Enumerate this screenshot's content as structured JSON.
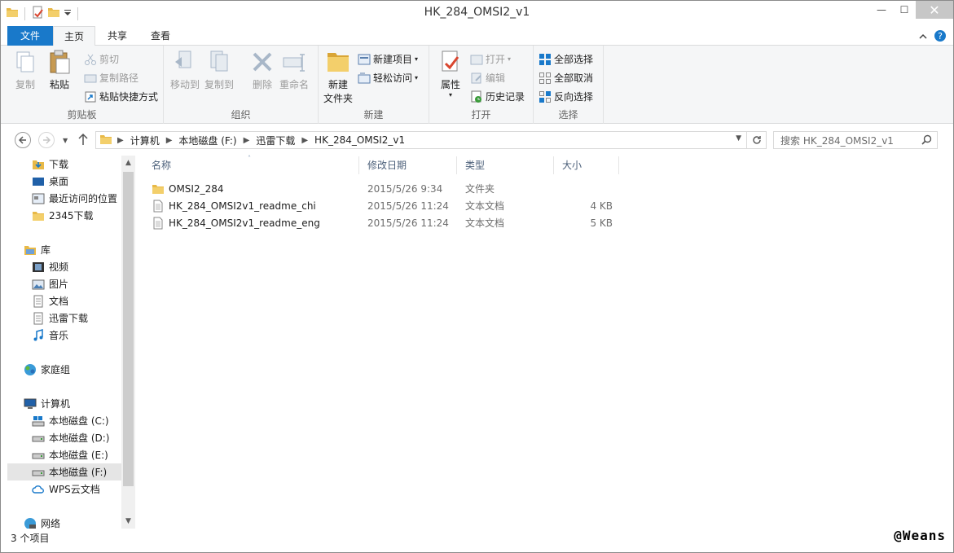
{
  "window": {
    "title": "HK_284_OMSI2_v1",
    "minimize": "—",
    "maximize": "☐",
    "close": "✕"
  },
  "tabs": [
    "文件",
    "主页",
    "共享",
    "查看"
  ],
  "ribbon": {
    "clipboard": {
      "label": "剪贴板",
      "copy": "复制",
      "paste": "粘贴",
      "cut": "剪切",
      "copy_path": "复制路径",
      "paste_shortcut": "粘贴快捷方式"
    },
    "organize": {
      "label": "组织",
      "move_to": "移动到",
      "copy_to": "复制到",
      "delete": "删除",
      "rename": "重命名"
    },
    "new": {
      "label": "新建",
      "new_folder_line1": "新建",
      "new_folder_line2": "文件夹",
      "new_item": "新建项目",
      "easy_access": "轻松访问"
    },
    "open": {
      "label": "打开",
      "properties": "属性",
      "open": "打开",
      "edit": "编辑",
      "history": "历史记录"
    },
    "select": {
      "label": "选择",
      "select_all": "全部选择",
      "select_none": "全部取消",
      "invert": "反向选择"
    }
  },
  "address": {
    "crumbs": [
      "计算机",
      "本地磁盘 (F:)",
      "迅雷下载",
      "HK_284_OMSI2_v1"
    ],
    "search_placeholder": "搜索 HK_284_OMSI2_v1"
  },
  "nav": {
    "favorites": [
      "下载",
      "桌面",
      "最近访问的位置",
      "2345下载"
    ],
    "libraries_title": "库",
    "libraries": [
      "视频",
      "图片",
      "文档",
      "迅雷下载",
      "音乐"
    ],
    "homegroup": "家庭组",
    "computer_title": "计算机",
    "drives": [
      "本地磁盘 (C:)",
      "本地磁盘 (D:)",
      "本地磁盘 (E:)",
      "本地磁盘 (F:)"
    ],
    "wps": "WPS云文档",
    "network": "网络"
  },
  "columns": {
    "name": "名称",
    "date": "修改日期",
    "type": "类型",
    "size": "大小"
  },
  "files": [
    {
      "name": "OMSI2_284",
      "date": "2015/5/26 9:34",
      "type": "文件夹",
      "size": "",
      "icon": "folder-icon"
    },
    {
      "name": "HK_284_OMSI2v1_readme_chi",
      "date": "2015/5/26 11:24",
      "type": "文本文档",
      "size": "4 KB",
      "icon": "text-file-icon"
    },
    {
      "name": "HK_284_OMSI2v1_readme_eng",
      "date": "2015/5/26 11:24",
      "type": "文本文档",
      "size": "5 KB",
      "icon": "text-file-icon"
    }
  ],
  "status": {
    "count": "3 个项目"
  },
  "watermark": "@Weans",
  "colors": {
    "file_tab": "#1979ca",
    "folder": "#e8b947",
    "ribbon_bg": "#f5f6f7"
  }
}
